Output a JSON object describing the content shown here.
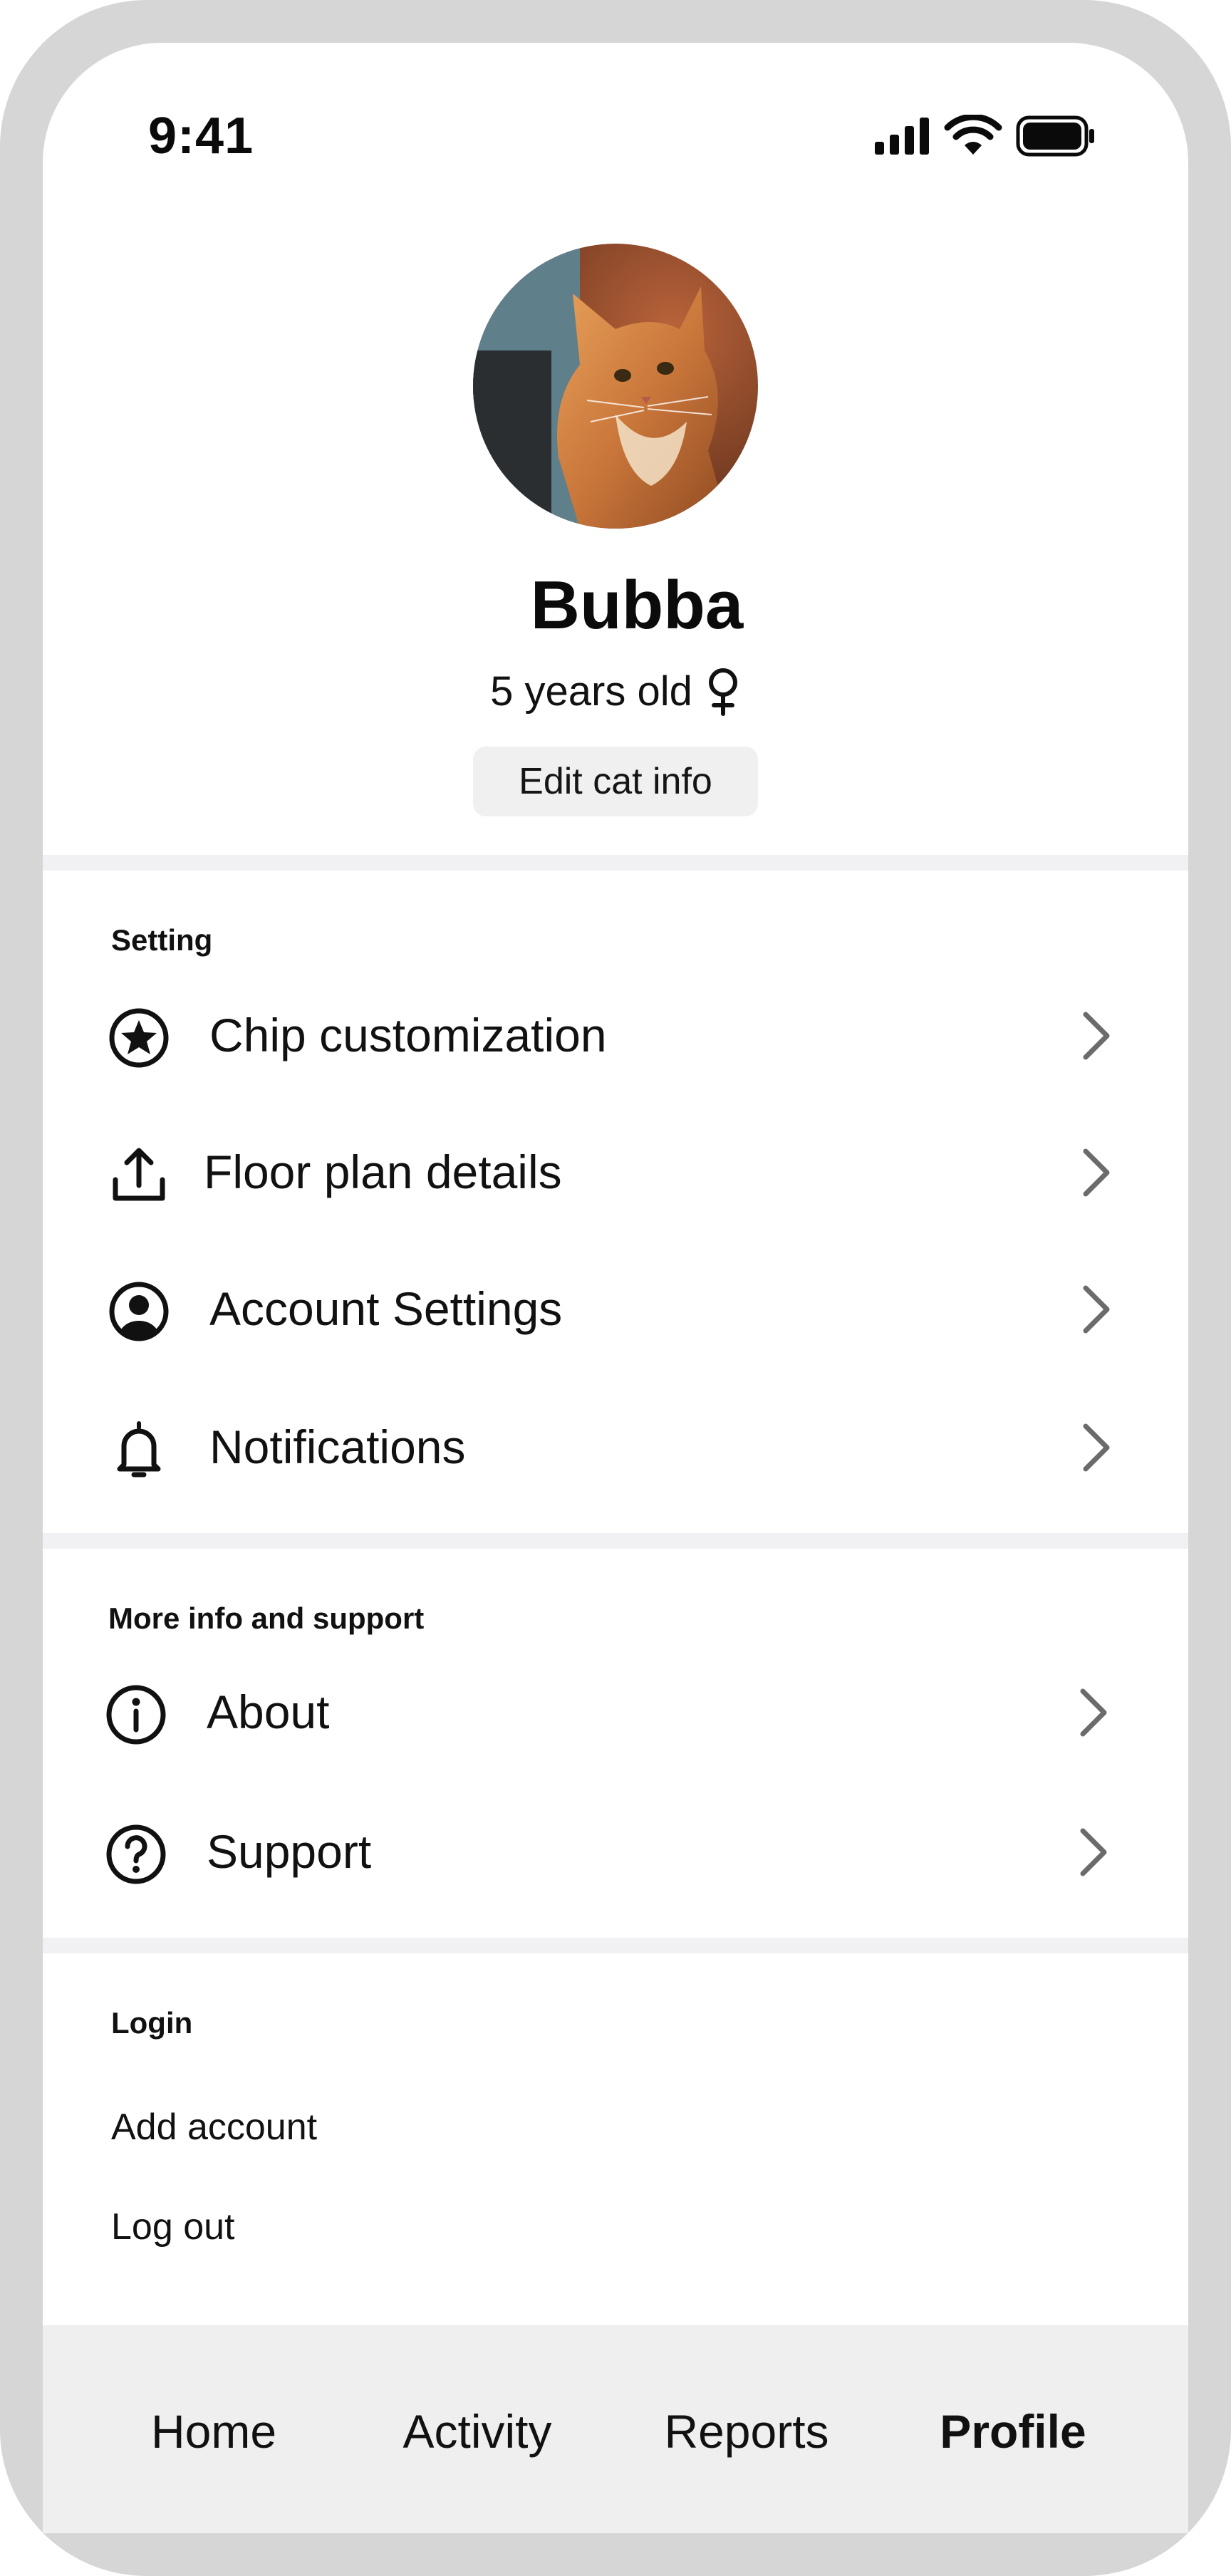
{
  "status_bar": {
    "time": "9:41"
  },
  "profile": {
    "name": "Bubba",
    "age": "5 years old",
    "gender_icon": "female-symbol-icon",
    "edit_button": "Edit cat info"
  },
  "settings": {
    "title": "Setting",
    "items": [
      {
        "label": "Chip customization",
        "icon": "star-circle-icon"
      },
      {
        "label": "Floor plan details",
        "icon": "upload-icon"
      },
      {
        "label": "Account Settings",
        "icon": "user-circle-icon"
      },
      {
        "label": "Notifications",
        "icon": "bell-icon"
      }
    ]
  },
  "support": {
    "title": "More info and support",
    "items": [
      {
        "label": "About",
        "icon": "info-icon"
      },
      {
        "label": "Support",
        "icon": "help-circle-icon"
      }
    ]
  },
  "login": {
    "title": "Login",
    "add_account": "Add account",
    "log_out": "Log out"
  },
  "tabbar": {
    "tabs": [
      {
        "label": "Home",
        "active": false
      },
      {
        "label": "Activity",
        "active": false
      },
      {
        "label": "Reports",
        "active": false
      },
      {
        "label": "Profile",
        "active": true
      }
    ]
  },
  "colors": {
    "frame": "#d6d6d6",
    "divider": "#f1f1f4",
    "tabbar_bg": "#efefef",
    "edit_button_bg": "#f0f0f0",
    "chevron": "#6b6b6b"
  }
}
